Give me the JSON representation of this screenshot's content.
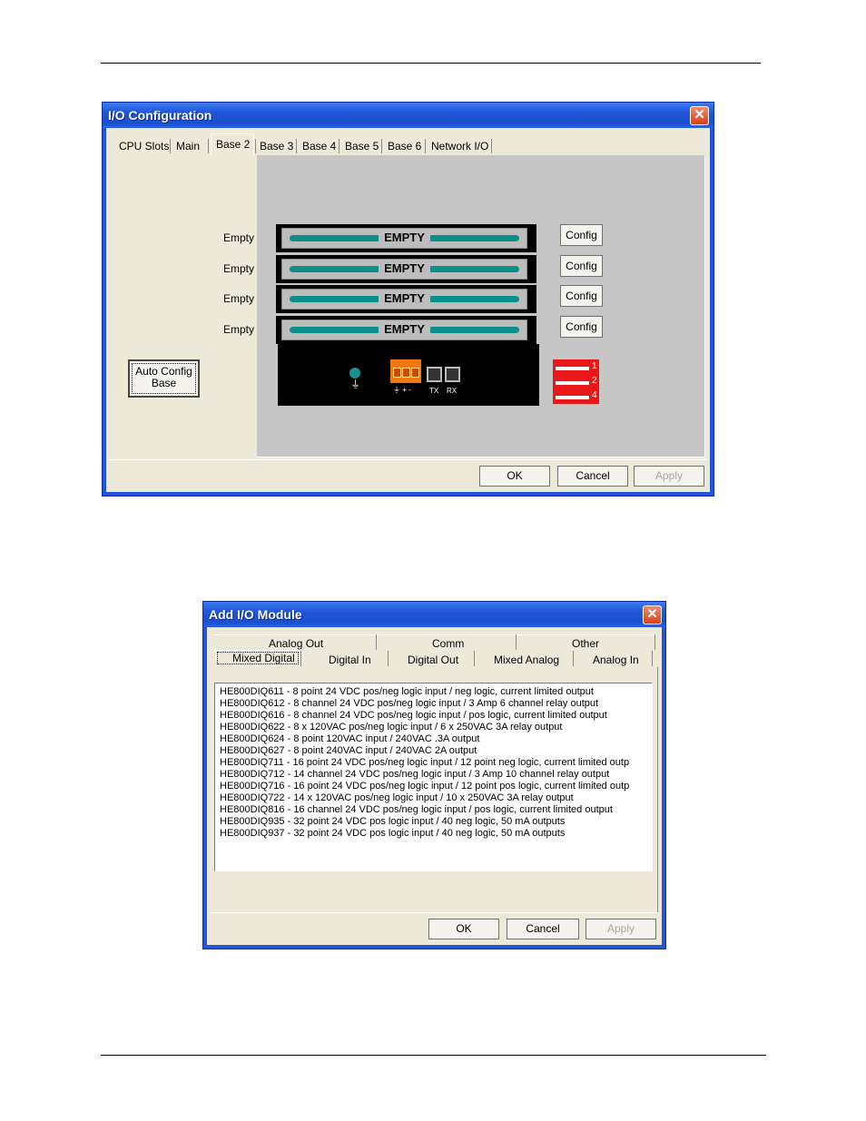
{
  "io_config": {
    "title": "I/O Configuration",
    "close": "✕",
    "tabs": [
      "CPU Slots",
      "Main",
      "Base 2",
      "Base 3",
      "Base 4",
      "Base 5",
      "Base 6",
      "Network I/O"
    ],
    "active_tab": "Base 2",
    "slots": [
      {
        "status": "Empty",
        "card": "EMPTY",
        "button": "Config"
      },
      {
        "status": "Empty",
        "card": "EMPTY",
        "button": "Config"
      },
      {
        "status": "Empty",
        "card": "EMPTY",
        "button": "Config"
      },
      {
        "status": "Empty",
        "card": "EMPTY",
        "button": "Config"
      }
    ],
    "auto_config_line1": "Auto Config",
    "auto_config_line2": "Base",
    "terminal_labels": "⏚ + -",
    "tx_label": "TX",
    "rx_label": "RX",
    "dip_numbers": [
      "1",
      "2",
      "4"
    ],
    "ok": "OK",
    "cancel": "Cancel",
    "apply": "Apply",
    "colors": {
      "accent": "#2454d8",
      "card_bar": "#0a8f8a",
      "terminal": "#f07810",
      "dip": "#e81818"
    }
  },
  "add_io": {
    "title": "Add I/O Module",
    "close": "✕",
    "tabs_row1": [
      "Analog Out",
      "Comm",
      "Other"
    ],
    "tabs_row2": [
      "Mixed Digital",
      "Digital In",
      "Digital Out",
      "Mixed Analog",
      "Analog In"
    ],
    "active_tab": "Mixed Digital",
    "modules": [
      "HE800DIQ611  -  8 point 24 VDC pos/neg logic input / neg logic, current limited output",
      "HE800DIQ612  -  8 channel 24 VDC pos/neg logic input / 3 Amp 6 channel relay output",
      "HE800DIQ616  -  8 channel 24 VDC pos/neg logic input / pos logic, current limited output",
      "HE800DIQ622  -  8 x 120VAC pos/neg logic input / 6 x 250VAC 3A relay output",
      "HE800DIQ624  -  8 point 120VAC input / 240VAC .3A output",
      "HE800DIQ627  -  8 point 240VAC input / 240VAC 2A output",
      "HE800DIQ711  -  16 point 24 VDC pos/neg logic input / 12 point neg logic, current limited outp",
      "HE800DIQ712  -  14 channel 24 VDC pos/neg logic input / 3 Amp 10 channel relay output",
      "HE800DIQ716  -  16 point 24 VDC pos/neg logic input / 12 point pos logic, current limited outp",
      "HE800DIQ722  -  14 x 120VAC pos/neg logic input / 10 x 250VAC 3A relay output",
      "HE800DIQ816  -  16 channel 24 VDC pos/neg logic input / pos logic, current limited output",
      "HE800DIQ935  -  32 point 24 VDC pos logic input / 40 neg logic, 50 mA outputs",
      "HE800DIQ937  -  32 point 24 VDC pos logic input / 40 neg logic, 50 mA outputs"
    ],
    "ok": "OK",
    "cancel": "Cancel",
    "apply": "Apply"
  }
}
